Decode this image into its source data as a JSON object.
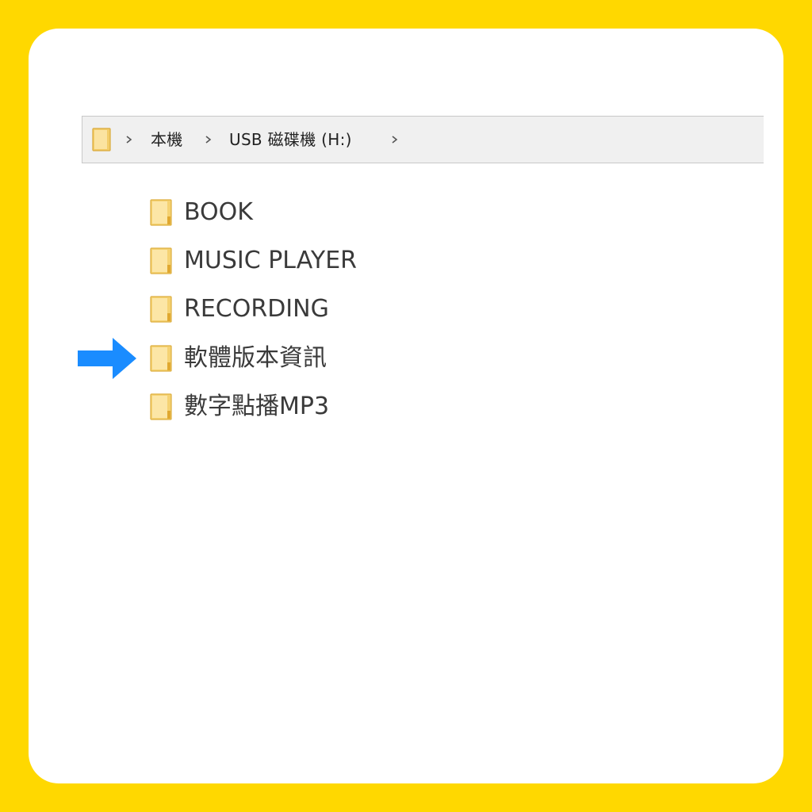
{
  "address_bar": {
    "root_icon": "folder-icon",
    "separator_icon": "chevron-right-icon",
    "crumbs": [
      {
        "label": "本機"
      },
      {
        "label": "USB 磁碟機 (H:)"
      }
    ]
  },
  "folders": [
    {
      "name": "BOOK",
      "icon": "folder-icon"
    },
    {
      "name": "MUSIC PLAYER",
      "icon": "folder-icon"
    },
    {
      "name": "RECORDING",
      "icon": "folder-icon"
    },
    {
      "name": "軟體版本資訊",
      "icon": "folder-icon",
      "highlighted": true
    },
    {
      "name": "數字點播MP3",
      "icon": "folder-icon"
    }
  ],
  "pointer": {
    "icon": "arrow-right-icon",
    "color": "#1A8CFF"
  },
  "colors": {
    "background": "#FFD800",
    "card": "#FFFFFF",
    "folder_fill": "#F5D272",
    "arrow": "#1A8CFF"
  }
}
